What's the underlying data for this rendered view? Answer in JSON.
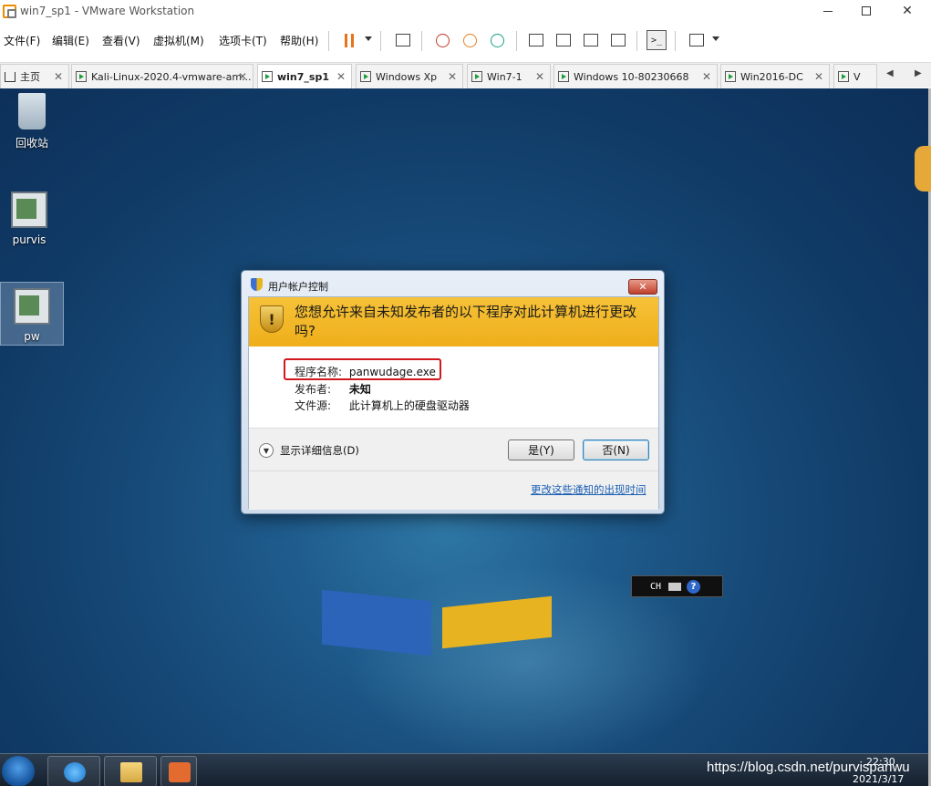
{
  "window": {
    "title": "win7_sp1 - VMware Workstation"
  },
  "menu": {
    "file": "文件(F)",
    "edit": "编辑(E)",
    "view": "查看(V)",
    "vm": "虚拟机(M)",
    "tabs": "选项卡(T)",
    "help": "帮助(H)"
  },
  "tabs": [
    {
      "label": "主页",
      "icon": "home-icon"
    },
    {
      "label": "Kali-Linux-2020.4-vmware-am...",
      "icon": "vm-icon"
    },
    {
      "label": "win7_sp1",
      "icon": "vm-icon",
      "active": true
    },
    {
      "label": "Windows Xp",
      "icon": "vm-icon"
    },
    {
      "label": "Win7-1",
      "icon": "vm-icon"
    },
    {
      "label": "Windows 10-80230668",
      "icon": "vm-icon"
    },
    {
      "label": "Win2016-DC",
      "icon": "vm-icon"
    },
    {
      "label": "V",
      "icon": "vm-icon"
    }
  ],
  "desktop": {
    "icons": [
      {
        "label": "回收站",
        "icon": "recycle-bin-icon"
      },
      {
        "label": "purvis",
        "icon": "program-icon"
      },
      {
        "label": "pw",
        "icon": "program-icon"
      }
    ]
  },
  "uac": {
    "title": "用户帐户控制",
    "close": "✕",
    "question": "您想允许来自未知发布者的以下程序对此计算机进行更改吗?",
    "program_label": "程序名称:",
    "program_value": "panwudage.exe",
    "publisher_label": "发布者:",
    "publisher_value": "未知",
    "source_label": "文件源:",
    "source_value": "此计算机上的硬盘驱动器",
    "details": "显示详细信息(D)",
    "yes": "是(Y)",
    "no": "否(N)",
    "link": "更改这些通知的出现时间",
    "highlight_color": "#d0181e"
  },
  "langbar": {
    "lang": "CH",
    "help": "?"
  },
  "taskbar": {
    "time": "22:30",
    "date": "2021/3/17"
  },
  "watermark": "https://blog.csdn.net/purvispanwu",
  "colors": {
    "accent_orange": "#e8731a",
    "uac_banner": "#f6c239",
    "link": "#1a5fb4"
  }
}
